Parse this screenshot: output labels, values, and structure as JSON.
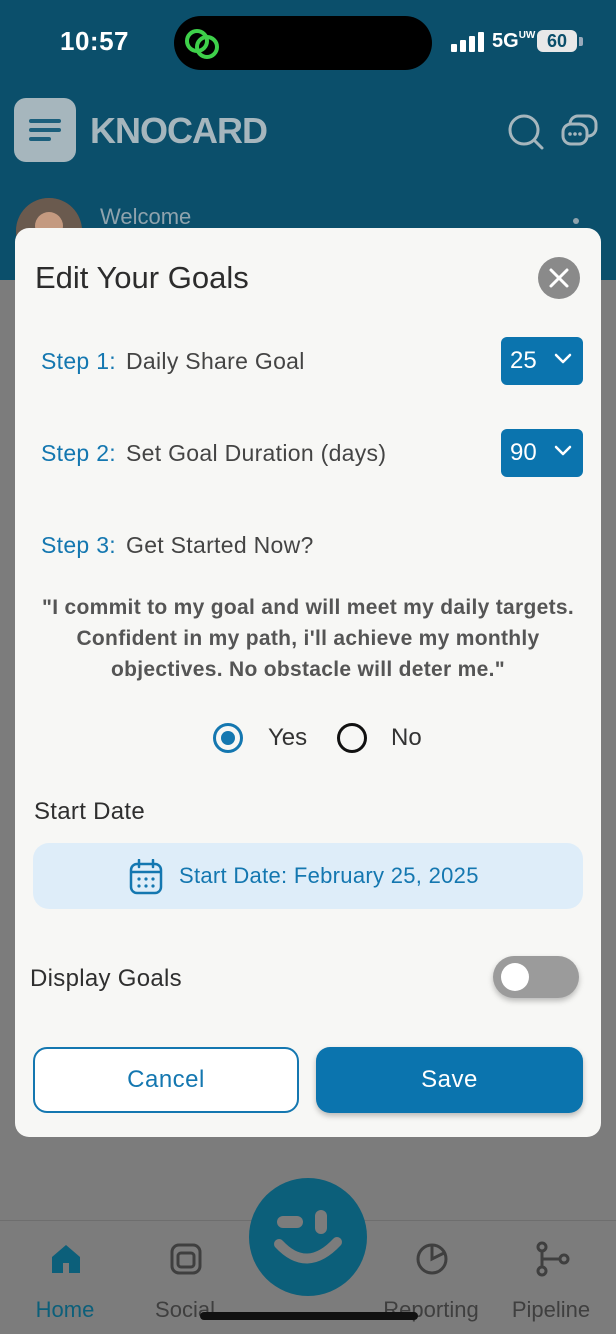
{
  "status_bar": {
    "time": "10:57",
    "network": "5G",
    "network_suffix": "UW",
    "battery": "60"
  },
  "header": {
    "logo_text": "KNOCARD",
    "welcome": "Welcome"
  },
  "modal": {
    "title": "Edit Your Goals",
    "steps": [
      {
        "number": "Step 1:",
        "label": "Daily Share Goal",
        "value": "25"
      },
      {
        "number": "Step 2:",
        "label": "Set Goal Duration (days)",
        "value": "90"
      },
      {
        "number": "Step 3:",
        "label": "Get Started Now?"
      }
    ],
    "commitment_quote": "\"I commit to my goal and will meet my daily targets. Confident in my path, i'll achieve my monthly objectives. No obstacle will deter me.\"",
    "radio": {
      "yes_label": "Yes",
      "no_label": "No",
      "selected": "Yes"
    },
    "start_date_label": "Start Date",
    "start_date_button": "Start Date: February 25, 2025",
    "display_goals_label": "Display Goals",
    "display_goals_enabled": false,
    "cancel_label": "Cancel",
    "save_label": "Save"
  },
  "tabbar": {
    "items": [
      {
        "label": "Home",
        "icon": "home-icon",
        "active": true
      },
      {
        "label": "Social",
        "icon": "social-icon"
      },
      {
        "label": "Reporting",
        "icon": "reporting-icon"
      },
      {
        "label": "Pipeline",
        "icon": "pipeline-icon"
      }
    ]
  },
  "colors": {
    "primary": "#0b74ae",
    "accent_text": "#1477b0",
    "header_bg": "#0b4f6b",
    "scrim": "#7c7c7c"
  }
}
